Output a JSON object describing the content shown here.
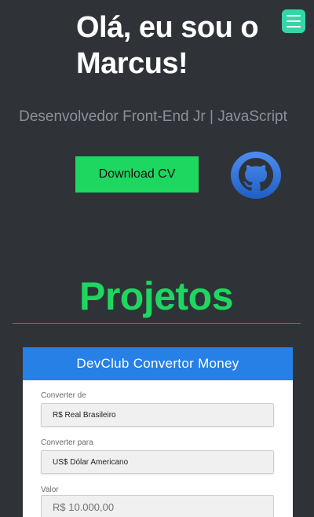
{
  "hero": {
    "title": "Olá, eu sou o Marcus!",
    "subtitle": "Desenvolvedor Front-End Jr | JavaScript",
    "download_label": "Download CV"
  },
  "icons": {
    "menu": "hamburger-menu-icon",
    "github": "github-octocat-icon"
  },
  "projects": {
    "title": "Projetos",
    "card": {
      "title": "DevClub Convertor Money",
      "from_label": "Converter de",
      "from_value": "R$ Real Brasileiro",
      "to_label": "Converter para",
      "to_value": "US$ Dólar Americano",
      "value_label": "Valor",
      "value_placeholder": "R$ 10.000,00"
    }
  },
  "colors": {
    "background": "#2f3338",
    "accent_green": "#1ed760",
    "menu_teal": "#35d5a8",
    "card_header_blue": "#2680e6",
    "subtitle_gray": "#8d9197"
  }
}
